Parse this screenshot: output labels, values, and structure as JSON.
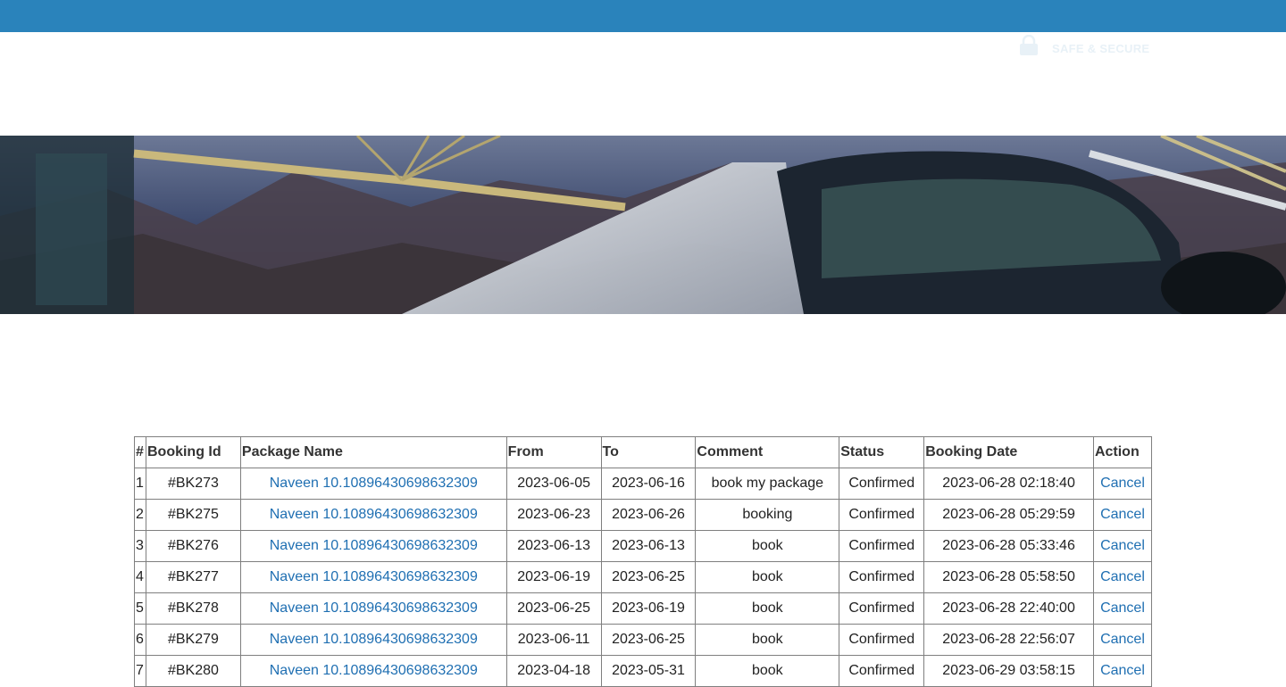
{
  "header": {
    "secure_label": "SAFE & SECURE",
    "bar_color": "#2a83bb"
  },
  "banner": {
    "image": "bus-mountain-banner"
  },
  "table": {
    "columns": [
      "#",
      "Booking Id",
      "Package Name",
      "From",
      "To",
      "Comment",
      "Status",
      "Booking Date",
      "Action"
    ],
    "rows": [
      {
        "num": "1",
        "booking_id": "#BK273",
        "package": "Naveen 10.10896430698632309",
        "from": "2023-06-05",
        "to": "2023-06-16",
        "comment": "book my package",
        "status": "Confirmed",
        "date": "2023-06-28 02:18:40",
        "action": "Cancel"
      },
      {
        "num": "2",
        "booking_id": "#BK275",
        "package": "Naveen 10.10896430698632309",
        "from": "2023-06-23",
        "to": "2023-06-26",
        "comment": "booking",
        "status": "Confirmed",
        "date": "2023-06-28 05:29:59",
        "action": "Cancel"
      },
      {
        "num": "3",
        "booking_id": "#BK276",
        "package": "Naveen 10.10896430698632309",
        "from": "2023-06-13",
        "to": "2023-06-13",
        "comment": "book",
        "status": "Confirmed",
        "date": "2023-06-28 05:33:46",
        "action": "Cancel"
      },
      {
        "num": "4",
        "booking_id": "#BK277",
        "package": "Naveen 10.10896430698632309",
        "from": "2023-06-19",
        "to": "2023-06-25",
        "comment": "book",
        "status": "Confirmed",
        "date": "2023-06-28 05:58:50",
        "action": "Cancel"
      },
      {
        "num": "5",
        "booking_id": "#BK278",
        "package": "Naveen 10.10896430698632309",
        "from": "2023-06-25",
        "to": "2023-06-19",
        "comment": "book",
        "status": "Confirmed",
        "date": "2023-06-28 22:40:00",
        "action": "Cancel"
      },
      {
        "num": "6",
        "booking_id": "#BK279",
        "package": "Naveen 10.10896430698632309",
        "from": "2023-06-11",
        "to": "2023-06-25",
        "comment": "book",
        "status": "Confirmed",
        "date": "2023-06-28 22:56:07",
        "action": "Cancel"
      },
      {
        "num": "7",
        "booking_id": "#BK280",
        "package": "Naveen 10.10896430698632309",
        "from": "2023-04-18",
        "to": "2023-05-31",
        "comment": "book",
        "status": "Confirmed",
        "date": "2023-06-29 03:58:15",
        "action": "Cancel"
      }
    ]
  }
}
